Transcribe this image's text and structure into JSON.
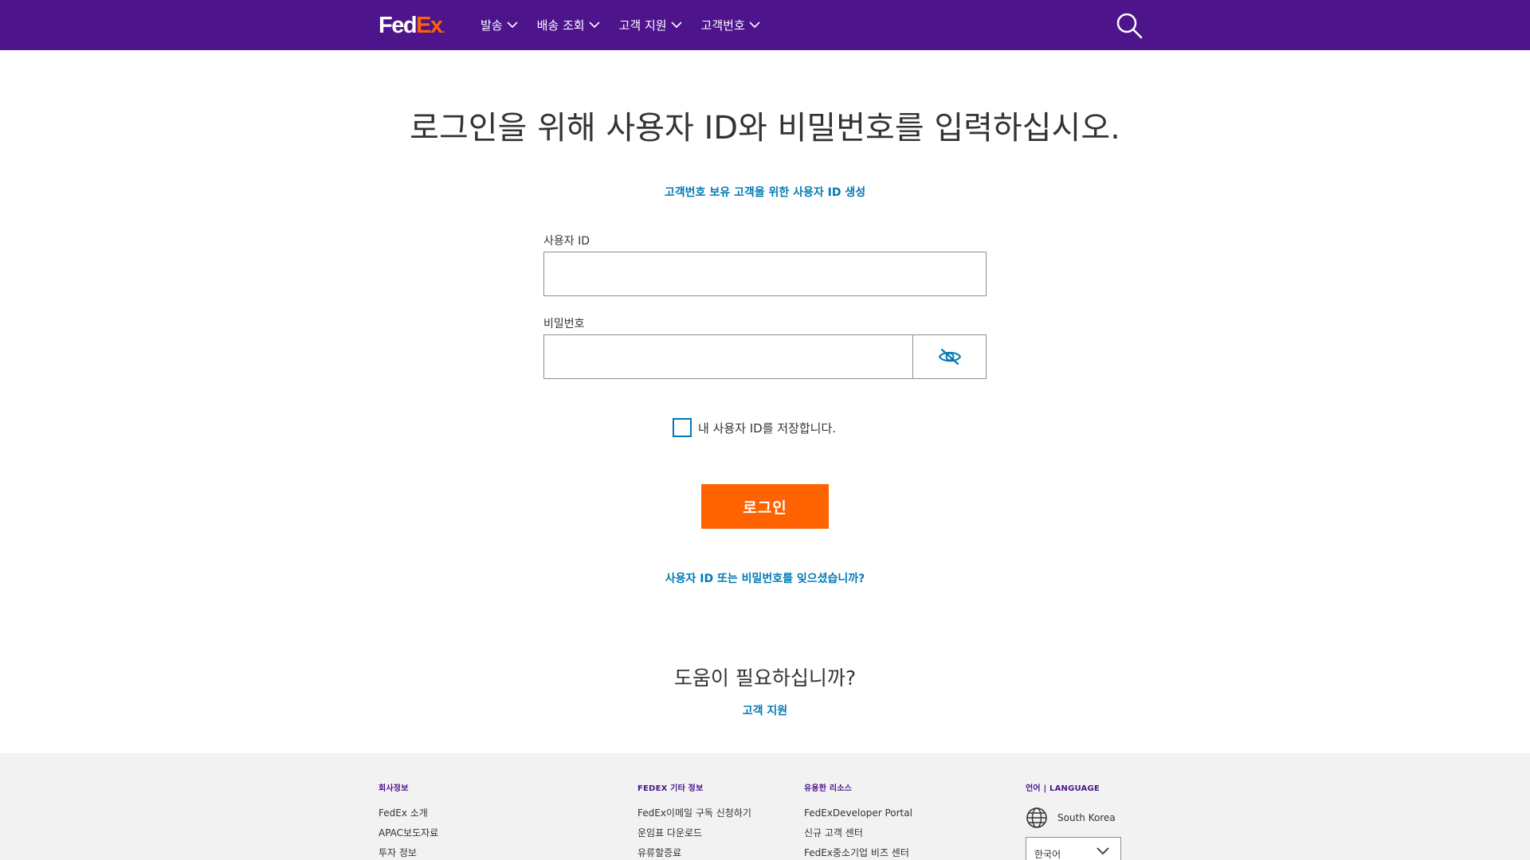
{
  "header": {
    "logo": {
      "fed": "Fed",
      "ex": "Ex",
      "dot": "."
    },
    "nav": [
      {
        "label": "발송"
      },
      {
        "label": "배송 조회"
      },
      {
        "label": "고객 지원"
      },
      {
        "label": "고객번호"
      }
    ]
  },
  "main": {
    "title": "로그인을 위해 사용자 ID와 비밀번호를 입력하십시오.",
    "create_link": "고객번호 보유 고객을 위한 사용자 ID 생성",
    "user_id_label": "사용자 ID",
    "user_id_value": "",
    "password_label": "비밀번호",
    "password_value": "",
    "remember_label": "내 사용자 ID를 저장합니다.",
    "login_button": "로그인",
    "forgot_link": "사용자 ID 또는 비밀번호를 잊으셨습니까?",
    "help_title": "도움이 필요하십니까?",
    "help_link": "고객 지원"
  },
  "footer": {
    "columns": [
      {
        "heading": "회사정보",
        "links": [
          "FedEx 소개",
          "APAC보도자료",
          "투자 정보"
        ]
      },
      {
        "heading": "FEDEX 기타 정보",
        "links": [
          "FedEx이메일 구독 신청하기",
          "운임표 다운로드",
          "유류할증료"
        ]
      },
      {
        "heading": "유용한 리소스",
        "links": [
          "FedExDeveloper Portal",
          "신규 고객 센터",
          "FedEx중소기업 비즈 센터"
        ]
      }
    ],
    "language": {
      "heading": "언어 | LANGUAGE",
      "country": "South Korea",
      "selected": "한국어"
    }
  },
  "colors": {
    "brand_purple": "#4d148c",
    "brand_orange": "#ff6200",
    "link_blue": "#007ab7"
  },
  "icons": {
    "search": "search-icon",
    "eye_hidden": "eye-slash-icon",
    "globe": "globe-icon",
    "chevron": "chevron-down-icon"
  }
}
